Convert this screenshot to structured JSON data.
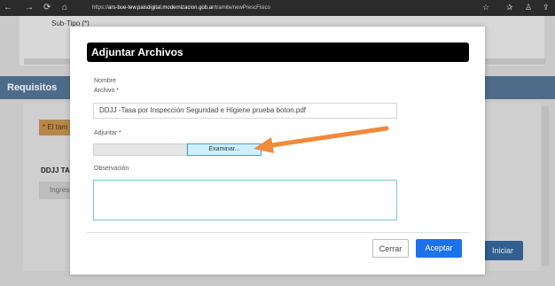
{
  "browser": {
    "back_icon": "←",
    "forward_icon": "→",
    "reload_icon": "⟳",
    "home_icon": "⌂",
    "url_prefix": "https://",
    "url_host": "ars-bue-tew.paisdigital.modernizacion.gob.ar",
    "url_path": "/tramite/newPrescFisico",
    "icons": [
      "☆",
      "✰",
      "♙",
      "⇪"
    ]
  },
  "background": {
    "sub_label": "Sub-Tipo (*)",
    "requisitos": "Requisitos",
    "warning": "* El tam",
    "ddjj_label": "DDJJ TAS",
    "ingres_text": "Ingres",
    "iniciar": "Iniciar"
  },
  "modal": {
    "title": "Adjuntar Archivos",
    "nombre_label": "Nombre",
    "archivo_label": "Archivo *",
    "archivo_value": "DDJJ -Tasa por Inspección Seguridad e Higiene prueba boton.pdf",
    "adjuntar_label": "Adjuntar *",
    "examinar_label": "Examinar...",
    "observacion_label": "Observación",
    "cerrar_label": "Cerrar",
    "aceptar_label": "Aceptar"
  }
}
